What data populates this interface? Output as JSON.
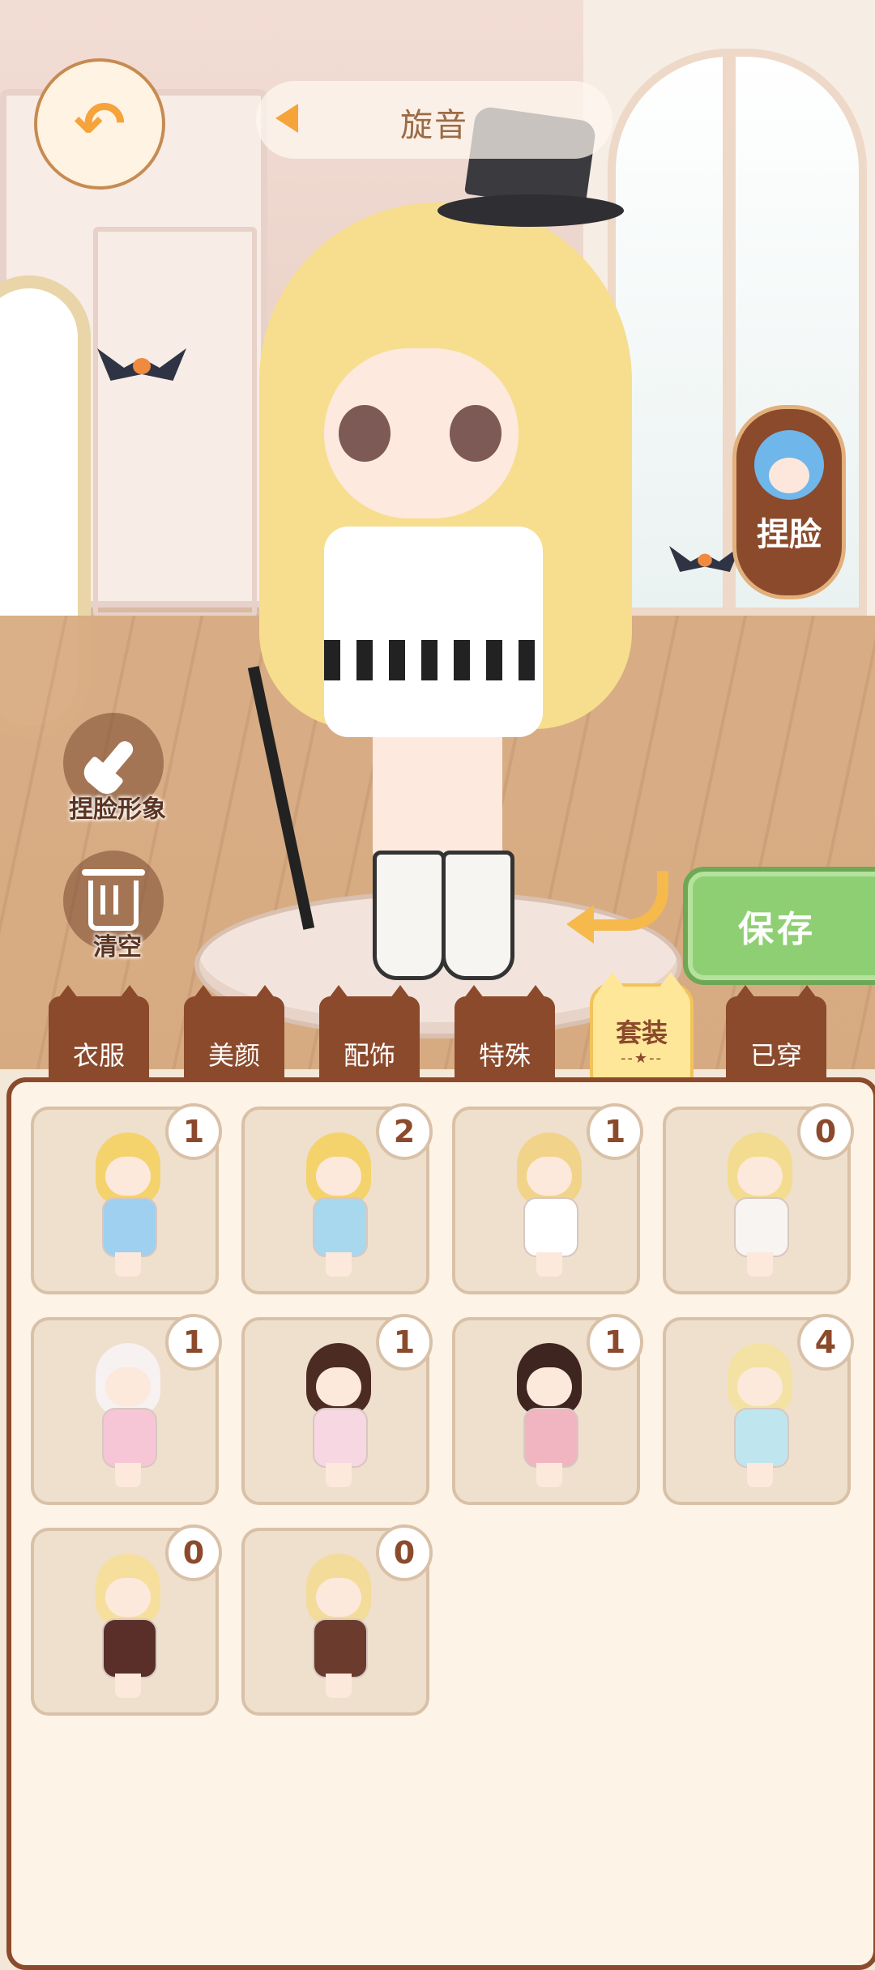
{
  "header": {
    "back_icon": "back-arrow-icon",
    "music_title": "旋音",
    "play_icon": "play-icon"
  },
  "side_buttons": {
    "pinch_face": "捏脸",
    "pinch_face_look": "捏脸形象",
    "clear": "清空"
  },
  "save_label": "保存",
  "tabs": [
    {
      "label": "衣服"
    },
    {
      "label": "美颜"
    },
    {
      "label": "配饰"
    },
    {
      "label": "特殊"
    },
    {
      "label": "套装",
      "active": true
    },
    {
      "label": "已穿"
    }
  ],
  "outfits": [
    {
      "count": "1",
      "hair": "#f4d36d",
      "outfit": "#9fd0f0"
    },
    {
      "count": "2",
      "hair": "#f4d36d",
      "outfit": "#a7d8ee"
    },
    {
      "count": "1",
      "hair": "#f1d48a",
      "outfit": "#ffffff"
    },
    {
      "count": "0",
      "hair": "#f3dc8f",
      "outfit": "#f7f4f2"
    },
    {
      "count": "1",
      "hair": "#f7f1f1",
      "outfit": "#f7c6d6"
    },
    {
      "count": "1",
      "hair": "#4b2b22",
      "outfit": "#f6d7e2"
    },
    {
      "count": "1",
      "hair": "#3f2520",
      "outfit": "#f0b5c0"
    },
    {
      "count": "4",
      "hair": "#f3e2a3",
      "outfit": "#bfe6ef"
    },
    {
      "count": "0",
      "hair": "#f6df9c",
      "outfit": "#5a2f2a"
    },
    {
      "count": "0",
      "hair": "#f3dc9a",
      "outfit": "#6b3b2e"
    }
  ],
  "colors": {
    "brown": "#8b4a2c",
    "accent": "#f6a33b",
    "save_green": "#8fcf74",
    "panel": "#fdf3e6"
  }
}
